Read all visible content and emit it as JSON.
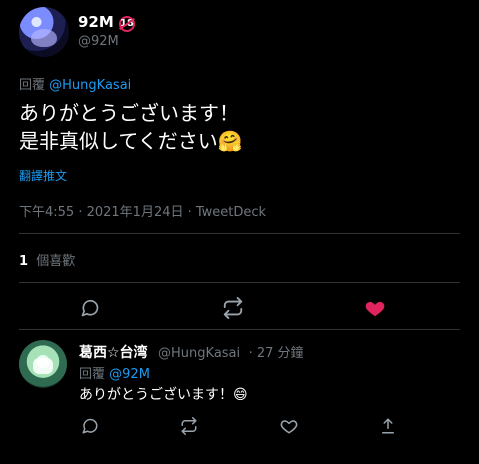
{
  "main_tweet": {
    "name": "92M",
    "name_badge": "18",
    "handle": "@92M",
    "reply_prefix": "回覆",
    "reply_to": "@HungKasai",
    "text_line1": "ありがとうございます！",
    "text_line2": "是非真似してください🤗",
    "translate": "翻譯推文",
    "timestamp": "下午4:55 · 2021年1月24日 · TweetDeck",
    "likes_count": "1",
    "likes_label": "個喜歡"
  },
  "reply_tweet": {
    "name": "葛西☆台湾",
    "handle": "@HungKasai",
    "time": "· 27 分鐘",
    "reply_prefix": "回覆",
    "reply_to": "@92M",
    "text": "ありがとうございます！😄"
  },
  "icons": {
    "reply": "reply-icon",
    "retweet": "retweet-icon",
    "like": "heart-icon",
    "share": "share-icon"
  },
  "colors": {
    "background": "#000000",
    "text_primary": "#ffffff",
    "text_muted": "#6e767d",
    "link": "#1d9bf0",
    "divider": "#2f3336",
    "like_active": "#e0245e",
    "badge": "#e0245e"
  }
}
